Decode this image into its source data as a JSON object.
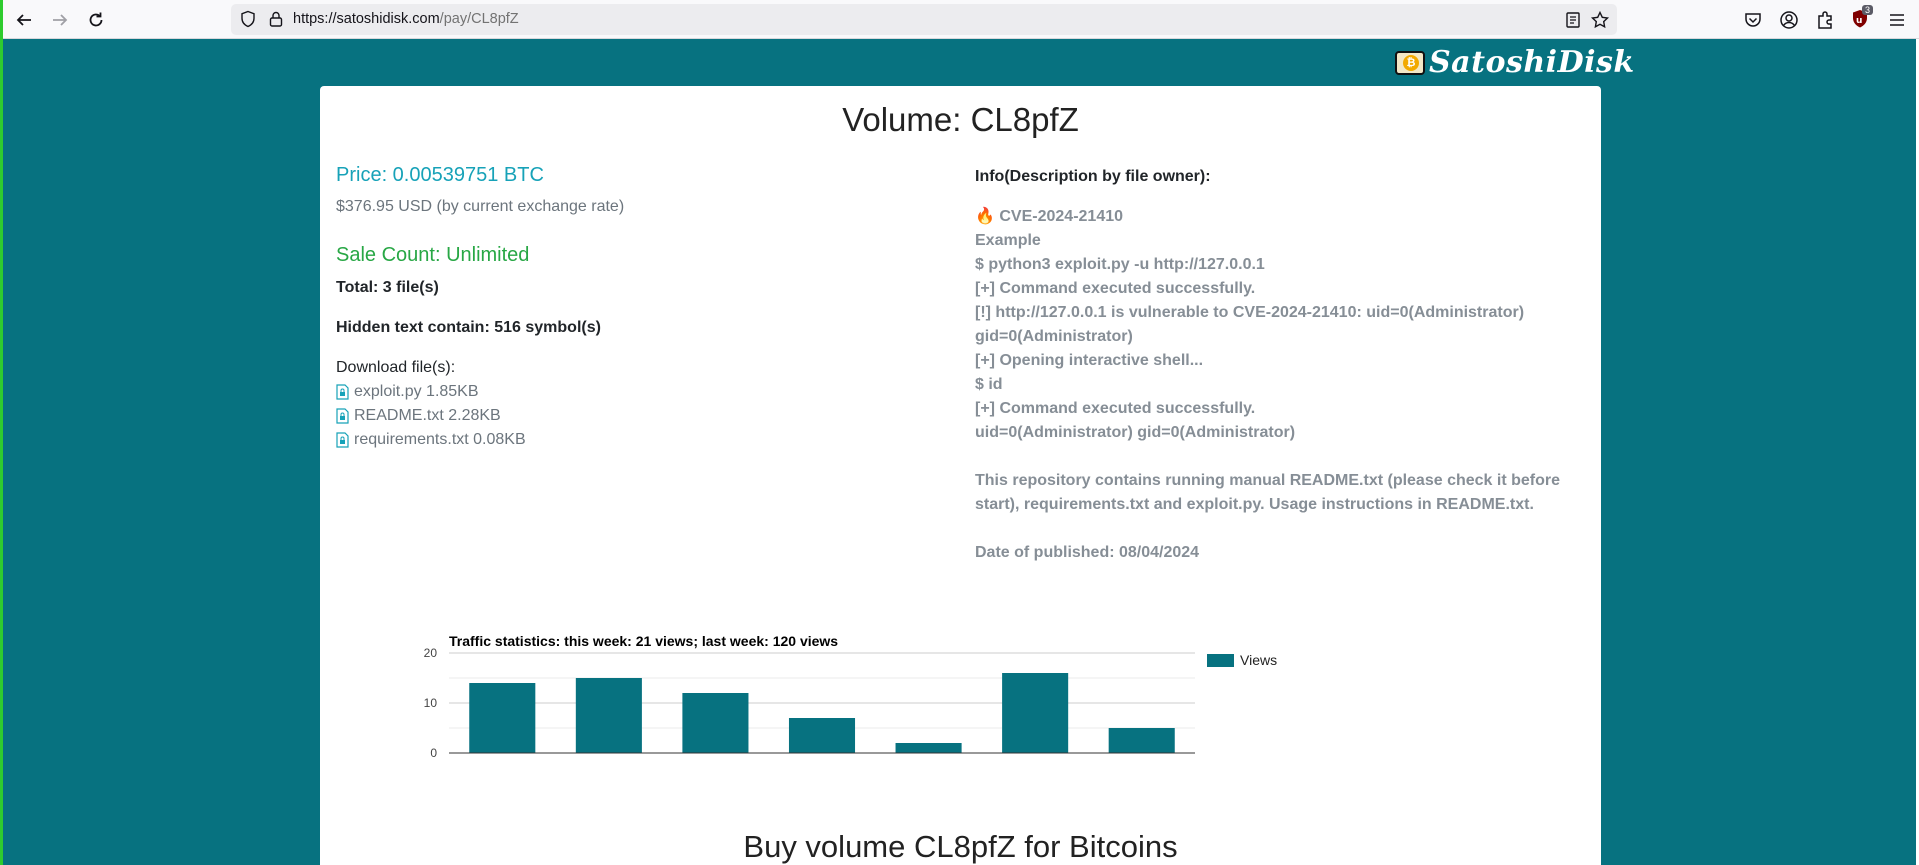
{
  "browser": {
    "url_host": "https://satoshidisk.com",
    "url_path": "/pay/CL8pfZ",
    "extensions_badge": "3"
  },
  "logo": {
    "text": "SatoshiDisk",
    "coin_glyph": "₿"
  },
  "volume": {
    "title": "Volume: CL8pfZ",
    "price": "Price: 0.00539751 BTC",
    "usd": "$376.95 USD (by current exchange rate)",
    "sale_count": "Sale Count: Unlimited",
    "total": "Total: 3 file(s)",
    "hidden_text": "Hidden text contain: 516 symbol(s)",
    "download_label": "Download file(s):",
    "files": [
      {
        "name": "exploit.py 1.85KB"
      },
      {
        "name": "README.txt 2.28KB"
      },
      {
        "name": "requirements.txt 0.08KB"
      }
    ]
  },
  "info": {
    "title": "Info(Description by file owner):",
    "cve_line": "🔥 CVE-2024-21410",
    "lines": [
      "Example",
      "$ python3 exploit.py -u http://127.0.0.1",
      "[+] Command executed successfully.",
      "[!] http://127.0.0.1 is vulnerable to CVE-2024-21410: uid=0(Administrator) gid=0(Administrator)",
      "[+] Opening interactive shell...",
      "$ id",
      "[+] Command executed successfully.",
      "uid=0(Administrator) gid=0(Administrator)"
    ],
    "description": "This repository contains running manual README.txt (please check it before start), requirements.txt and exploit.py. Usage instructions in README.txt.",
    "date": "Date of published: 08/04/2024"
  },
  "chart_data": {
    "type": "bar",
    "title": "Traffic statistics: this week: 21 views; last week: 120 views",
    "categories": [
      "",
      "",
      "",
      "",
      "",
      "",
      ""
    ],
    "series": [
      {
        "name": "Views",
        "values": [
          14,
          15,
          12,
          7,
          2,
          16,
          5
        ],
        "color": "#077280"
      }
    ],
    "ylim": [
      0,
      20
    ],
    "yticks": [
      0,
      10,
      20
    ],
    "grid": true,
    "legend": "right"
  },
  "buy_title": "Buy volume CL8pfZ for Bitcoins"
}
